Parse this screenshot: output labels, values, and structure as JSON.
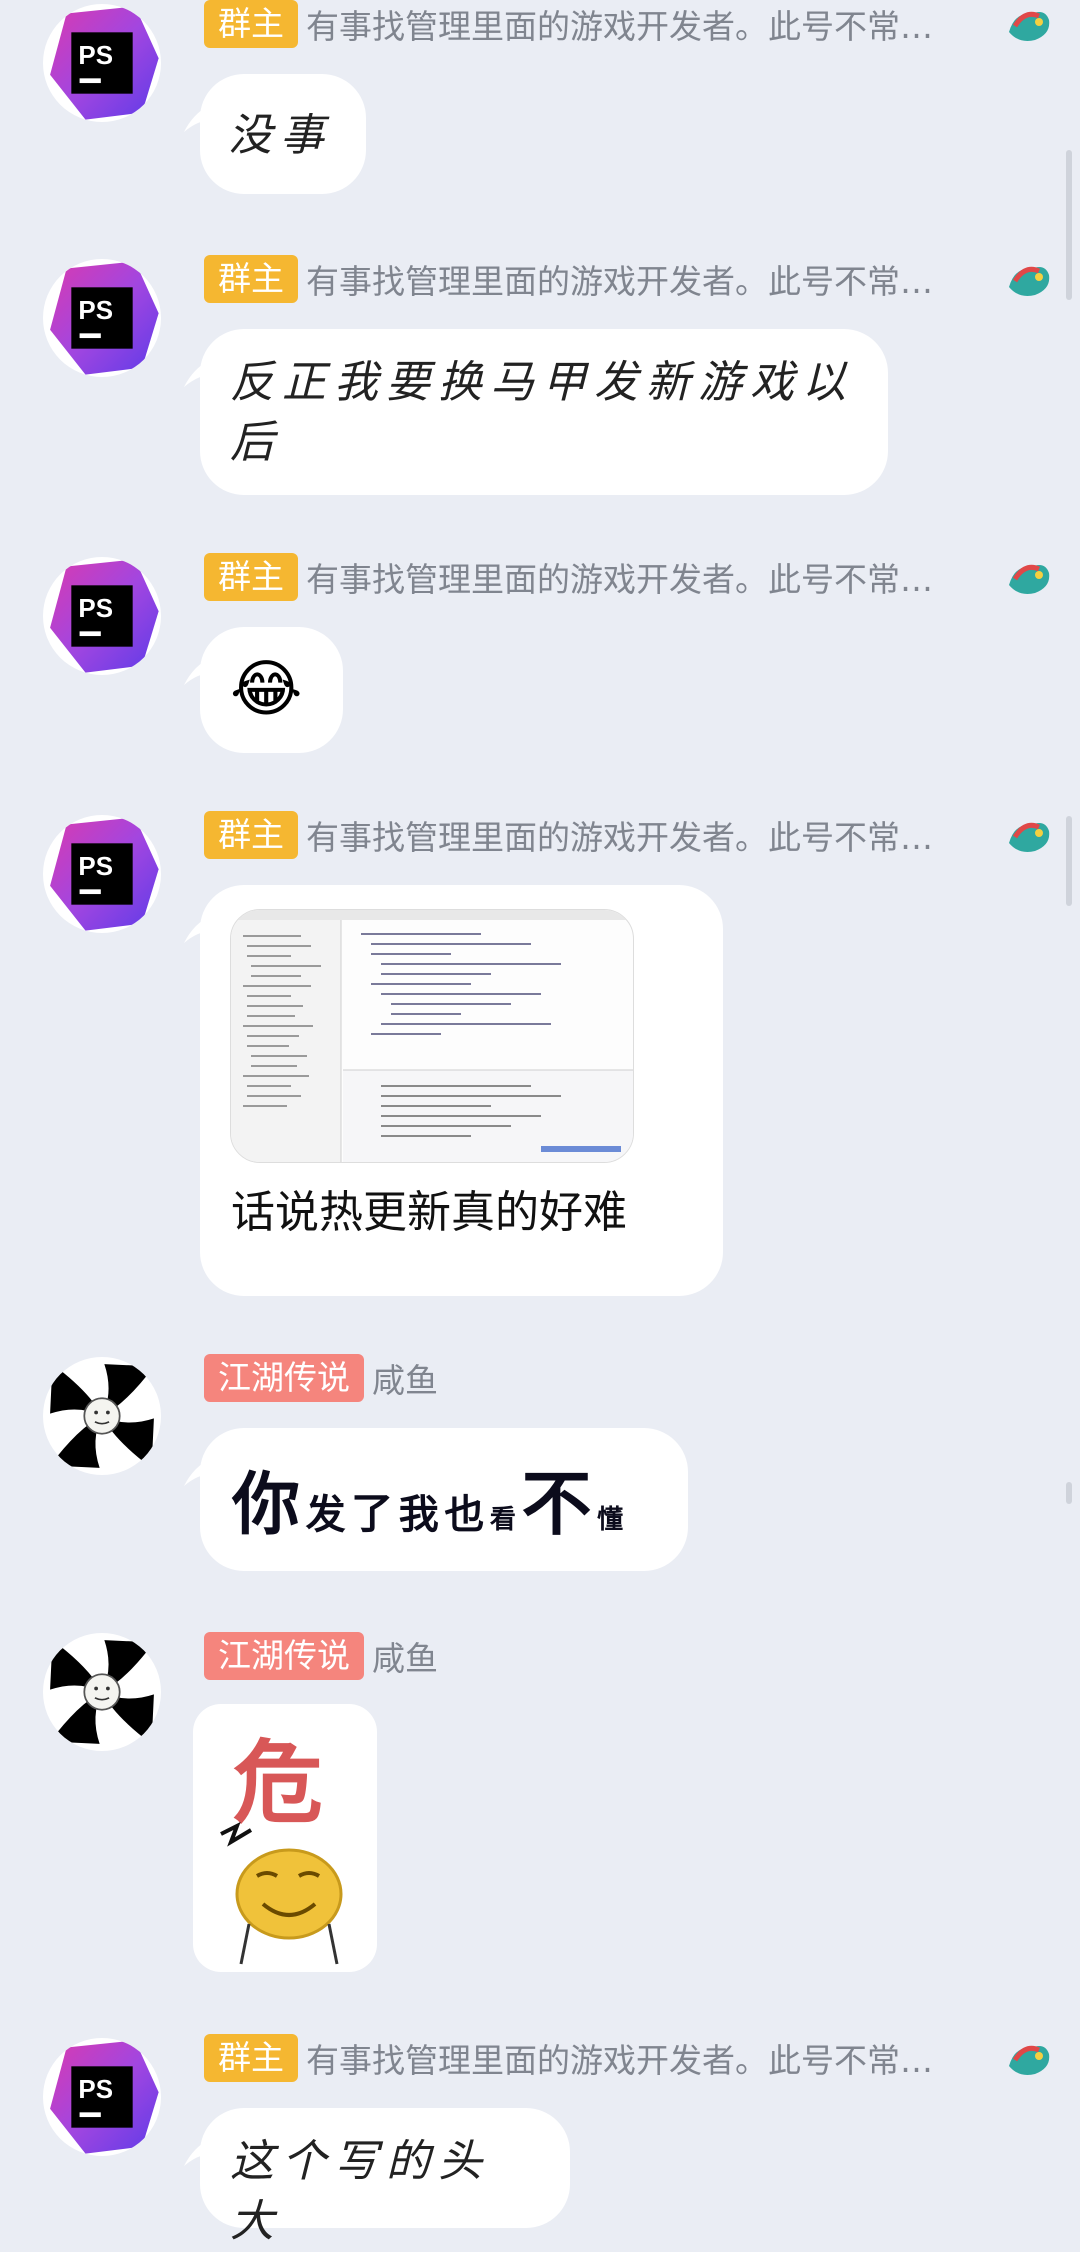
{
  "messages": [
    {
      "badge": "群主",
      "nickname": "有事找管理里面的游戏开发者。此号不常…",
      "text": "没事"
    },
    {
      "badge": "群主",
      "nickname": "有事找管理里面的游戏开发者。此号不常…",
      "text": "反正我要换马甲发新游戏以后"
    },
    {
      "badge": "群主",
      "nickname": "有事找管理里面的游戏开发者。此号不常…",
      "emoji": "😂"
    },
    {
      "badge": "群主",
      "nickname": "有事找管理里面的游戏开发者。此号不常…",
      "text": "话说热更新真的好难"
    },
    {
      "badge": "江湖传说",
      "nickname": "咸鱼",
      "sticker_text": [
        "你",
        "发",
        "了",
        "我",
        "也",
        "看",
        "不",
        "懂"
      ]
    },
    {
      "badge": "江湖传说",
      "nickname": "咸鱼",
      "sticker_text": [
        "危"
      ]
    },
    {
      "badge": "群主",
      "nickname": "有事找管理里面的游戏开发者。此号不常…",
      "text": "这个写的头大"
    }
  ],
  "icons": {
    "ps_avatar": "ps-logo-avatar",
    "fish_avatar": "meme-face-avatar",
    "flair": "dragon-icon"
  },
  "colors": {
    "background": "#EAEDF4",
    "owner_badge": "#F5B731",
    "title_badge": "#F5857D",
    "nickname": "#80858F"
  }
}
